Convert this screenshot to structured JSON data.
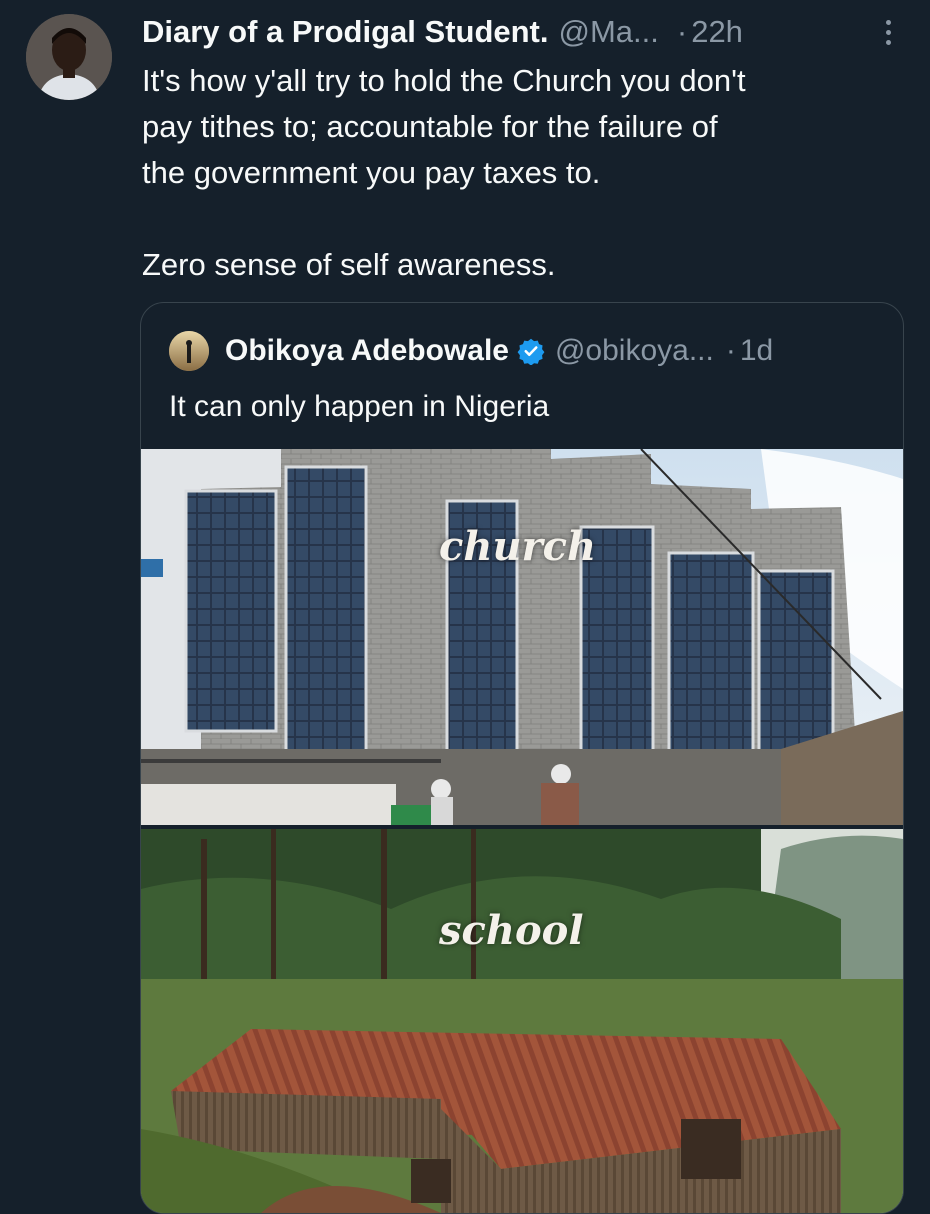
{
  "tweet": {
    "display_name": "Diary of a Prodigal Student.",
    "handle": "@Ma...",
    "separator": "·",
    "time": "22h",
    "text": "It's how y'all try to hold the Church you don't\npay tithes to; accountable for the failure of\nthe government you pay taxes to.\n\nZero sense of self awareness."
  },
  "quoted_tweet": {
    "display_name": "Obikoya Adebowale",
    "handle": "@obikoya...",
    "separator": "·",
    "time": "1d",
    "text": "It can only happen in Nigeria",
    "media": {
      "top_caption": "church",
      "bottom_caption": "school"
    }
  },
  "icons": {
    "more": "more-vertical-icon",
    "verified": "verified-badge-icon"
  },
  "colors": {
    "background": "#15202b",
    "text": "#f7f9f9",
    "secondary_text": "#8b98a5",
    "border": "#38444d",
    "verified": "#1d9bf0"
  }
}
